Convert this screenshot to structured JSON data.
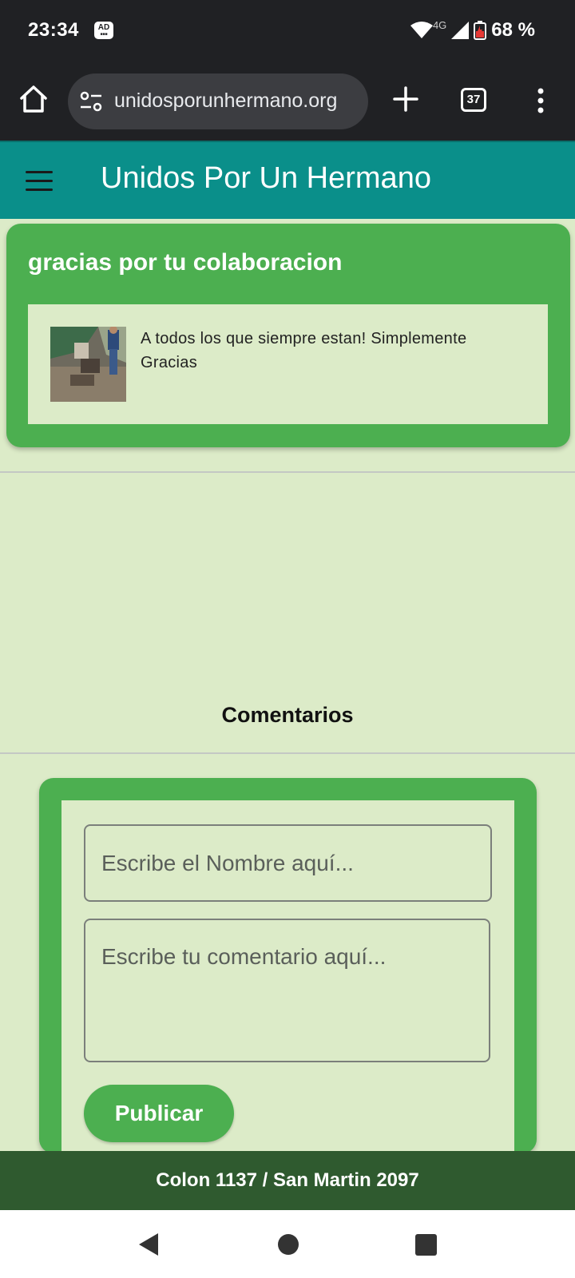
{
  "status_bar": {
    "time": "23:34",
    "ad_badge": "AD",
    "network": "4G",
    "battery": "68 %",
    "icons": [
      "ad-blocker-icon",
      "wifi-icon",
      "signal-icon",
      "battery-icon"
    ]
  },
  "browser": {
    "url": "unidosporunhermano.org",
    "tab_count": "37",
    "icons": [
      "home-icon",
      "site-settings-icon",
      "new-tab-icon",
      "tabs-icon",
      "more-menu-icon"
    ]
  },
  "header": {
    "title": "Unidos Por Un Hermano",
    "menu_icon": "hamburger-icon",
    "background": "#0a8f8a"
  },
  "post": {
    "title": "gracias por tu colaboracion",
    "message": "A todos los que siempre estan! Simplemente Gracias",
    "accent": "#4caf50"
  },
  "comments": {
    "heading": "Comentarios",
    "name_placeholder": "Escribe el Nombre aquí...",
    "comment_placeholder": "Escribe tu comentario aquí...",
    "publish_label": "Publicar"
  },
  "footer": {
    "address": "Colon 1137 / San Martin 2097",
    "background": "#2f5a2f"
  },
  "nav_bar": {
    "icons": [
      "back-icon",
      "home-circle-icon",
      "recents-icon"
    ]
  }
}
